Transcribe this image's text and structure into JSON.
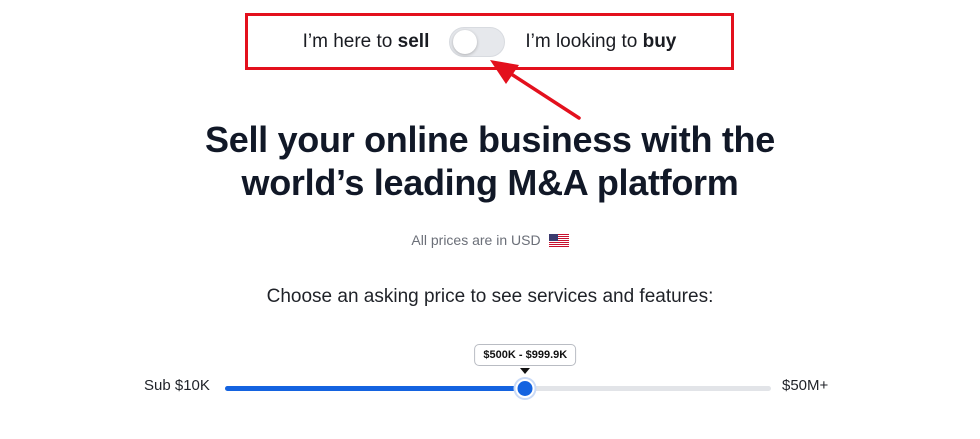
{
  "toggle": {
    "sell_prefix": "I’m here to ",
    "sell_bold": "sell",
    "buy_prefix": "I’m looking to ",
    "buy_bold": "buy",
    "selected": "sell"
  },
  "headline": {
    "line1": "Sell your online business with the",
    "line2": "world’s leading M&A platform"
  },
  "price_note": {
    "text": "All prices are in USD",
    "flag_icon": "us-flag-icon"
  },
  "choose_text": "Choose an asking price to see services and features:",
  "slider": {
    "min_label": "Sub $10K",
    "max_label": "$50M+",
    "value_label": "$500K - $999.9K",
    "fraction": 0.55
  },
  "colors": {
    "accent": "#1463e0",
    "highlight": "#e3101d"
  }
}
